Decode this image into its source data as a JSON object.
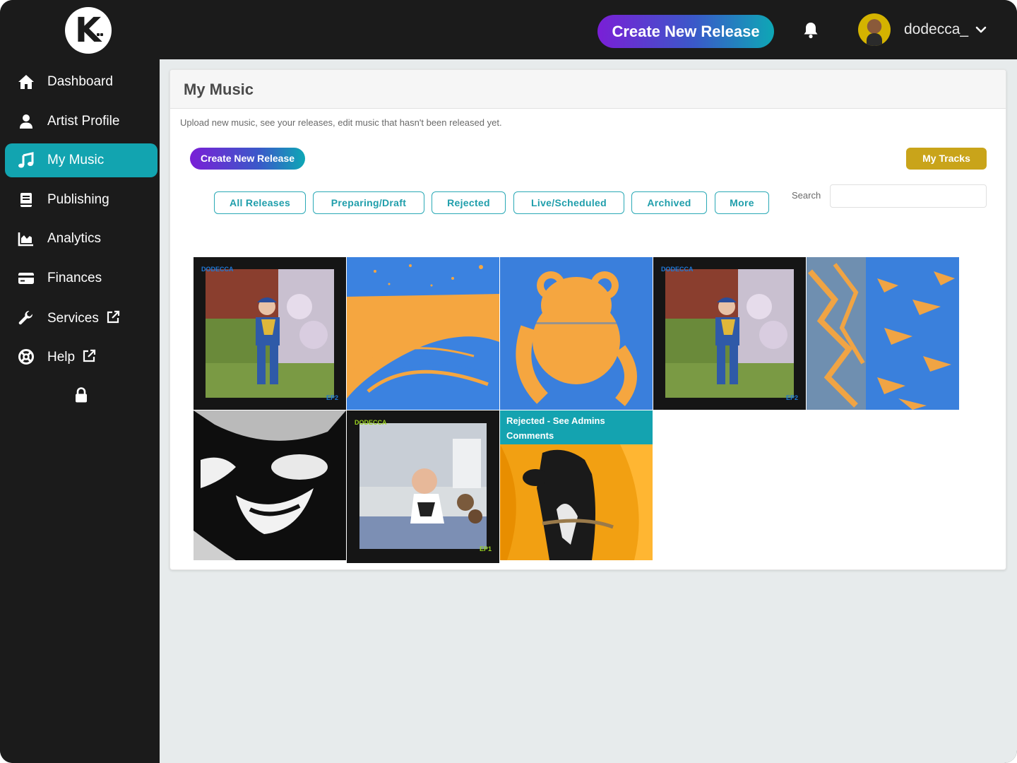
{
  "header": {
    "logo_letter": "K",
    "create_button": "Create New Release",
    "username": "dodecca_"
  },
  "sidebar": {
    "items": [
      {
        "label": "Dashboard",
        "icon": "home-icon"
      },
      {
        "label": "Artist Profile",
        "icon": "user-icon"
      },
      {
        "label": "My Music",
        "icon": "music-note-icon",
        "active": true
      },
      {
        "label": "Publishing",
        "icon": "book-icon"
      },
      {
        "label": "Analytics",
        "icon": "chart-icon"
      },
      {
        "label": "Finances",
        "icon": "credit-card-icon"
      },
      {
        "label": "Services",
        "icon": "wrench-icon",
        "external": true
      },
      {
        "label": "Help",
        "icon": "life-ring-icon",
        "external": true
      }
    ]
  },
  "page": {
    "title": "My Music",
    "description": "Upload new music, see your releases, edit music that hasn't been released yet.",
    "create_button": "Create New Release",
    "my_tracks_button": "My Tracks",
    "filters": [
      "All Releases",
      "Preparing/Draft",
      "Rejected",
      "Live/Scheduled",
      "Archived",
      "More"
    ],
    "search_label": "Search",
    "search_value": ""
  },
  "releases": [
    {
      "art": "boy-garden-ep2",
      "brand": "DODECCA",
      "tag": "EP2"
    },
    {
      "art": "orange-blue-abstract-swoosh"
    },
    {
      "art": "orange-blue-plush-toy"
    },
    {
      "art": "boy-garden-ep2",
      "brand": "DODECCA",
      "tag": "EP2"
    },
    {
      "art": "orange-blue-split-texture"
    },
    {
      "art": "bw-high-contrast-face"
    },
    {
      "art": "baby-photo-ep1",
      "brand": "DODECCA",
      "tag": "EP1"
    },
    {
      "art": "dog-orange-curtain",
      "status": "Rejected - See Admins Comments"
    }
  ],
  "colors": {
    "accent_teal": "#12a4b0",
    "sidebar_bg": "#1b1b1b",
    "gold": "#c9a41a",
    "gradient_start": "#7a1fd6",
    "gradient_end": "#0ea7b5"
  }
}
